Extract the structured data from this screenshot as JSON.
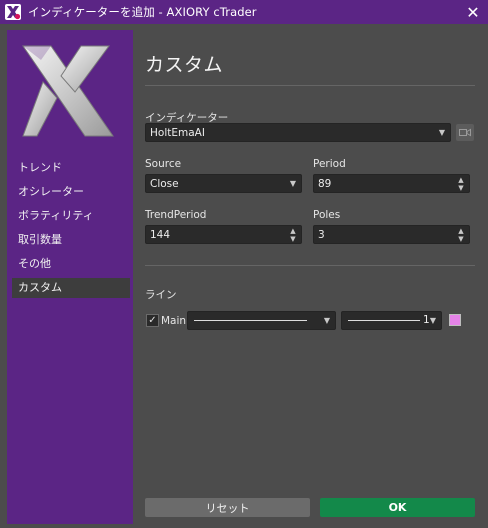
{
  "window": {
    "title": "インディケーターを追加 - AXIORY cTrader",
    "close_glyph": "✕"
  },
  "colors": {
    "brand_purple": "#5b2585",
    "ok_green": "#13894a",
    "line_color_swatch": "#e583e8"
  },
  "sidebar": {
    "logo_icon": "x-logo-icon",
    "items": [
      {
        "label": "トレンド"
      },
      {
        "label": "オシレーター"
      },
      {
        "label": "ボラティリティ"
      },
      {
        "label": "取引数量"
      },
      {
        "label": "その他"
      },
      {
        "label": "カスタム",
        "active": true
      }
    ]
  },
  "main": {
    "title": "カスタム",
    "indicator": {
      "label": "インディケーター",
      "value": "HoltEmaAI"
    },
    "params": {
      "source": {
        "label": "Source",
        "value": "Close"
      },
      "period": {
        "label": "Period",
        "value": "89"
      },
      "trend_period": {
        "label": "TrendPeriod",
        "value": "144"
      },
      "poles": {
        "label": "Poles",
        "value": "3"
      }
    },
    "lines": {
      "label": "ライン",
      "main": {
        "checked": true,
        "name": "Main",
        "thickness": "1"
      }
    }
  },
  "footer": {
    "reset_label": "リセット",
    "ok_label": "OK"
  }
}
